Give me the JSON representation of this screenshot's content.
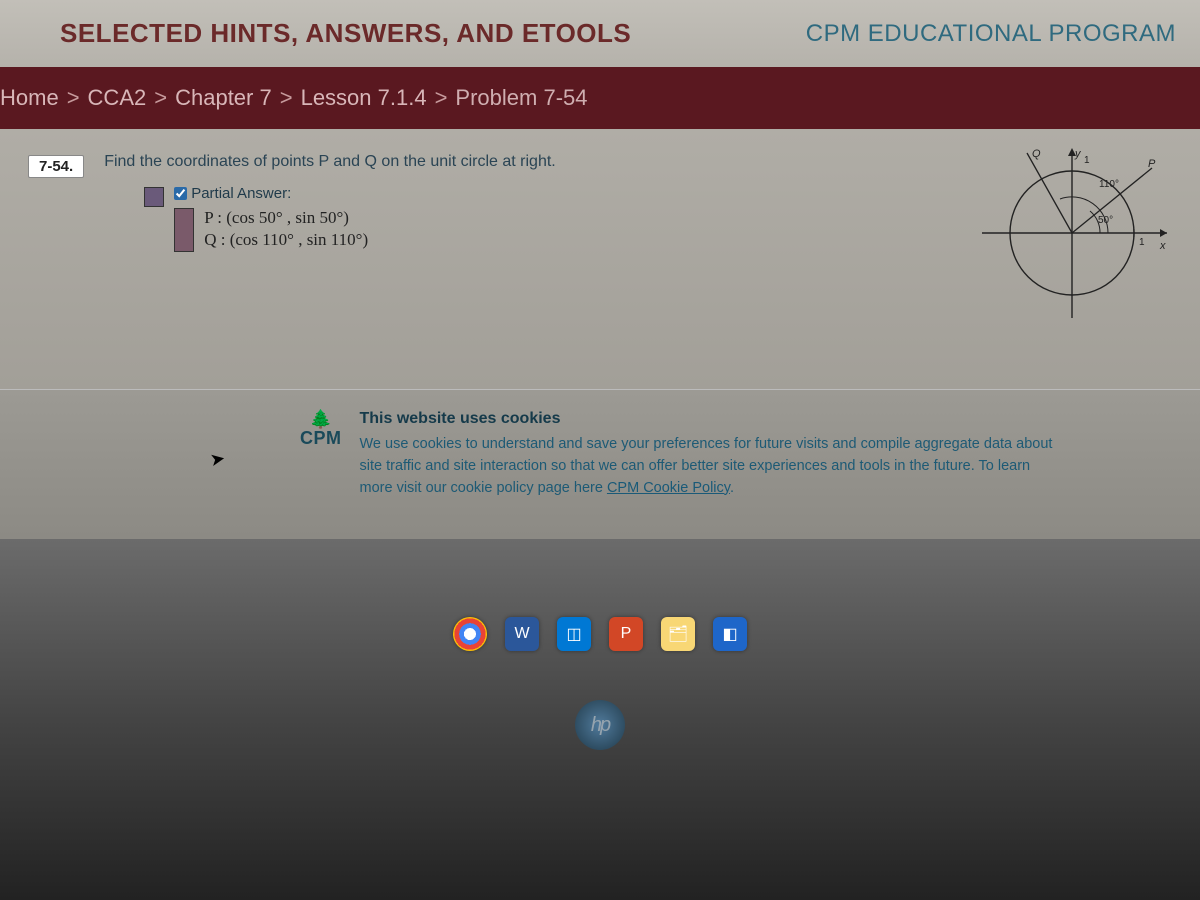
{
  "header": {
    "left": "SELECTED HINTS, ANSWERS, AND ETOOLS",
    "right": "CPM EDUCATIONAL PROGRAM"
  },
  "breadcrumb": {
    "items": [
      "Home",
      "CCA2",
      "Chapter 7",
      "Lesson 7.1.4",
      "Problem 7-54"
    ],
    "sep": ">"
  },
  "problem": {
    "number": "7-54.",
    "prompt": "Find the coordinates of points P and Q on the unit circle at right.",
    "partial_label": "Partial Answer:",
    "line_p": "P : (cos 50° , sin 50°)",
    "line_q": "Q : (cos 110° , sin 110°)"
  },
  "diagram": {
    "labels": {
      "Q": "Q",
      "P": "P",
      "y": "y",
      "one_y": "1",
      "one_x": "1",
      "x": "x",
      "a110": "110°",
      "a50": "50°"
    }
  },
  "cookie": {
    "logo": "CPM",
    "title": "This website uses cookies",
    "body_pre": "We use cookies to understand and save your preferences for future visits and compile aggregate data about site traffic and site interaction so that we can offer better site experiences and tools in the future. To learn more visit our cookie policy page here ",
    "link": "CPM Cookie Policy",
    "body_post": "."
  },
  "taskbar": {
    "icons": [
      "chrome",
      "word",
      "outlook",
      "powerpoint",
      "explorer",
      "app"
    ]
  },
  "hp": "hp"
}
